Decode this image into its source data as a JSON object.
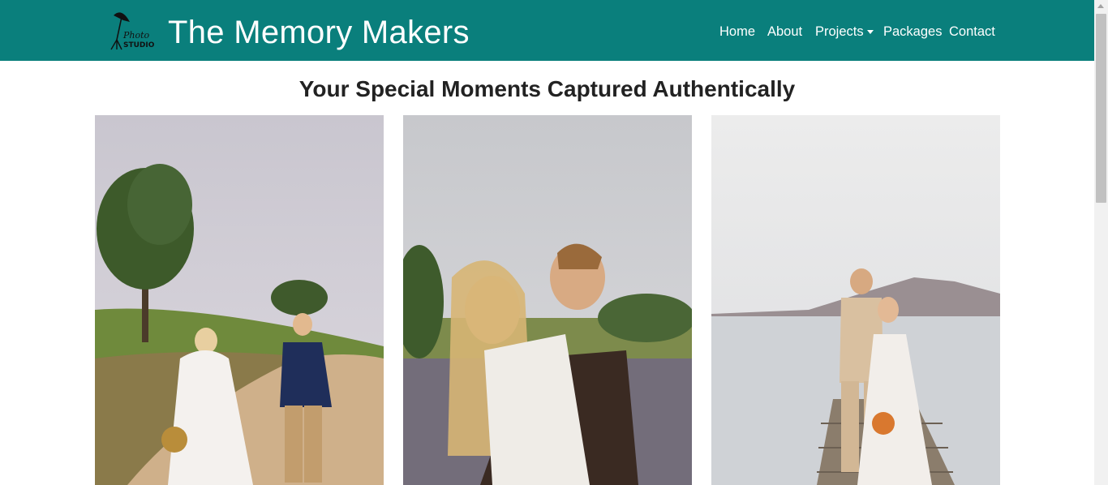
{
  "header": {
    "logo_text_line1": "Photo",
    "logo_text_line2": "STUDIO",
    "brand": "The Memory Makers",
    "nav": {
      "home": "Home",
      "about": "About",
      "projects": "Projects",
      "packages": "Packages",
      "contact": "Contact"
    }
  },
  "main": {
    "headline": "Your Special Moments Captured Authentically",
    "photos": [
      {
        "name": "wedding-photo-1",
        "description_icon": "couple-walking-path"
      },
      {
        "name": "wedding-photo-2",
        "description_icon": "couple-embracing-field"
      },
      {
        "name": "wedding-photo-3",
        "description_icon": "couple-on-jetty"
      }
    ]
  },
  "colors": {
    "navbar": "#0a7f7c",
    "headline": "#222222"
  }
}
